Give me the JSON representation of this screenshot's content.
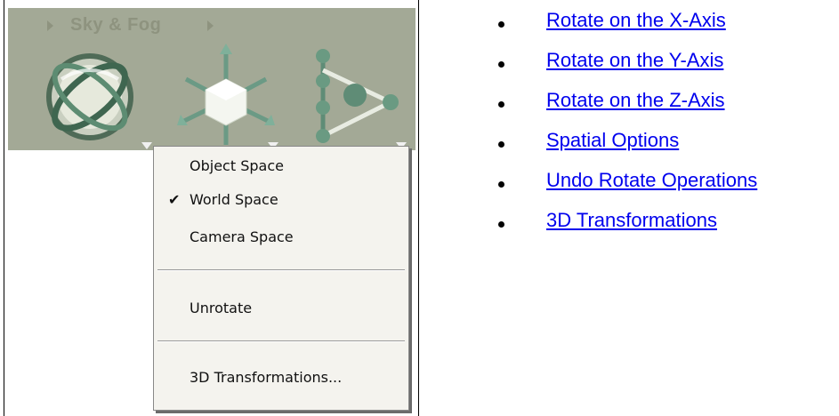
{
  "toolbar": {
    "title": "Sky & Fog",
    "icons": [
      "rotate-globe-icon",
      "move-cube-icon",
      "molecule-play-icon"
    ]
  },
  "menu": {
    "items": [
      {
        "label": "Object Space",
        "checked": false
      },
      {
        "label": "World Space",
        "checked": true
      },
      {
        "label": "Camera Space",
        "checked": false
      },
      {
        "label": "Unrotate",
        "checked": false
      },
      {
        "label": "3D Transformations...",
        "checked": false
      }
    ],
    "check_glyph": "✔"
  },
  "links": [
    "Rotate on the X-Axis",
    "Rotate on the Y-Axis",
    "Rotate on the Z-Axis",
    "Spatial Options",
    "Undo Rotate Operations",
    "3D Transformations"
  ],
  "colors": {
    "toolbar_bg": "#a3a996",
    "link": "#0000ee",
    "menu_bg": "#f4f3ee"
  }
}
